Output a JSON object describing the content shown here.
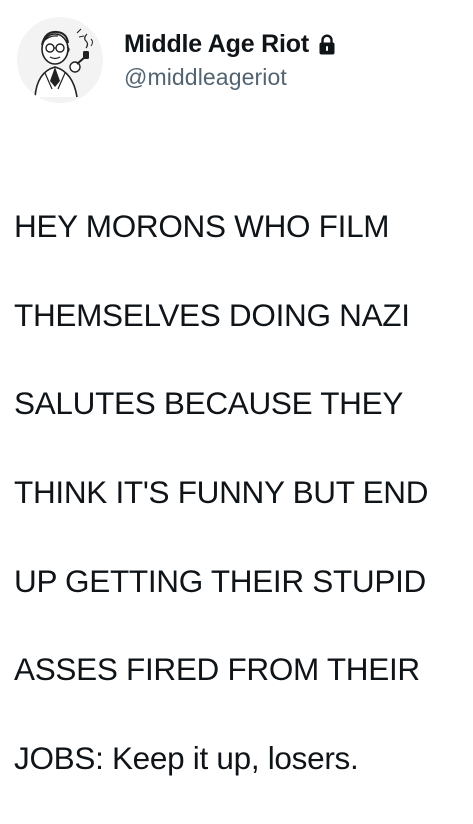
{
  "tweet": {
    "author": {
      "display_name": "Middle Age Riot",
      "handle": "@middleageriot",
      "avatar_icon": "vintage-man-drawing",
      "protected_icon": "lock-icon"
    },
    "text_lines": [
      "HEY MORONS WHO FILM",
      "THEMSELVES DOING NAZI",
      "SALUTES BECAUSE THEY",
      "THINK IT'S FUNNY BUT END",
      "UP GETTING THEIR STUPID",
      "ASSES FIRED FROM THEIR",
      "JOBS: Keep it up, losers."
    ]
  },
  "colors": {
    "text": "#0f1419",
    "secondary_text": "#536471",
    "background": "#ffffff"
  }
}
